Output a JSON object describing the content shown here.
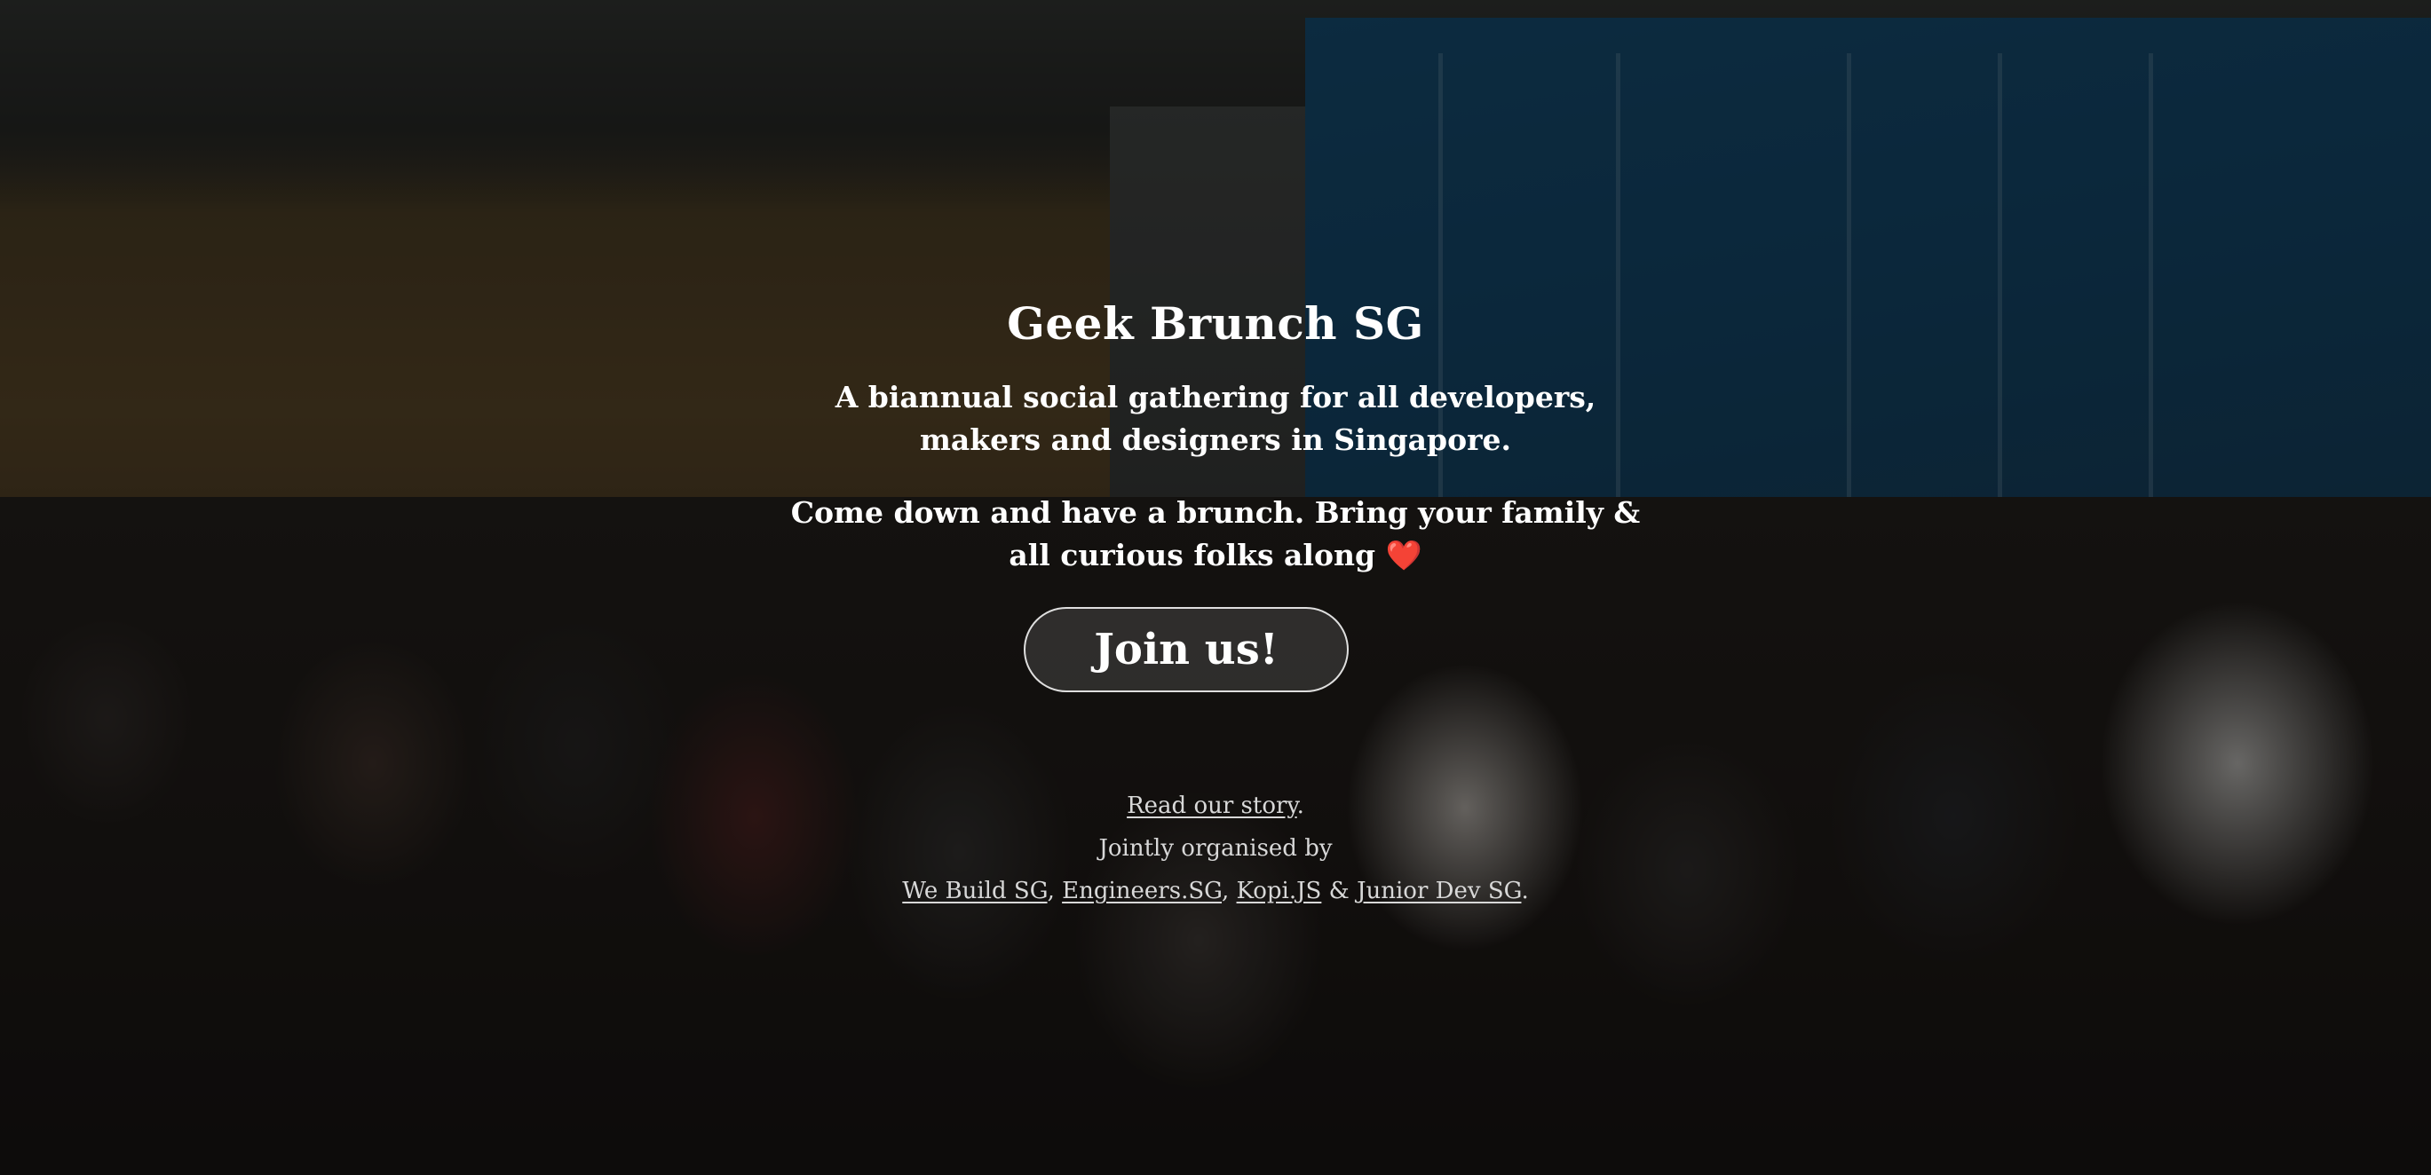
{
  "hero": {
    "title": "Geek Brunch SG",
    "tagline_line1": "A biannual social gathering for all developers,",
    "tagline_line2": "makers and designers in Singapore.",
    "invite_line1": "Come down and have a brunch. Bring your family &",
    "invite_line2": "all curious folks along",
    "heart": "❤️",
    "join_label": "Join us!"
  },
  "footer": {
    "story_link": "Read our story",
    "story_period": ".",
    "organised_text": "Jointly organised by",
    "organisers": [
      "We Build SG",
      "Engineers.SG",
      "Kopi.JS",
      "Junior Dev SG"
    ],
    "sep_comma_1": ", ",
    "sep_comma_2": ", ",
    "sep_amp": " & ",
    "end_period": "."
  },
  "colors": {
    "overlay": "#000000",
    "text": "#ffffff",
    "footer_text": "#d8d8d8",
    "heart": "#e22222"
  }
}
